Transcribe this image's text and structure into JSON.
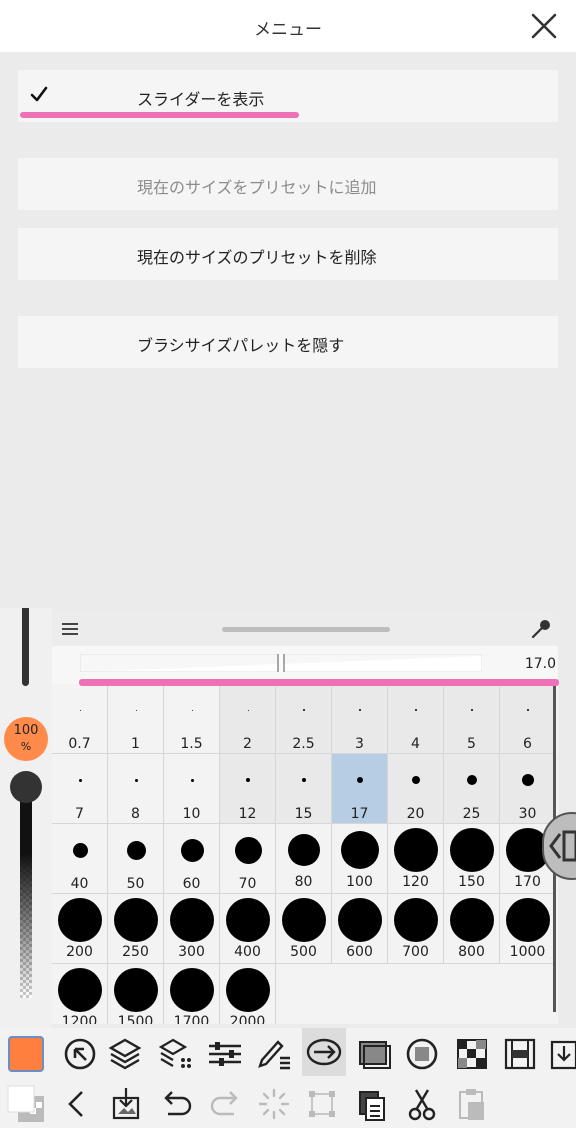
{
  "menu": {
    "title": "メニュー",
    "items": [
      {
        "label": "スライダーを表示",
        "checked": true,
        "disabled": false
      },
      {
        "label": "現在のサイズをプリセットに追加",
        "checked": false,
        "disabled": true
      },
      {
        "label": "現在のサイズのプリセットを削除",
        "checked": false,
        "disabled": false
      },
      {
        "label": "ブラシサイズパレットを隠す",
        "checked": false,
        "disabled": false
      }
    ]
  },
  "opacity": {
    "value": "100",
    "unit": "%",
    "level": 1.0
  },
  "brush_size": {
    "current": "17.0",
    "slider_fraction": 0.5,
    "selected": "17",
    "presets": [
      "0.7",
      "1",
      "1.5",
      "2",
      "2.5",
      "3",
      "4",
      "5",
      "6",
      "7",
      "8",
      "10",
      "12",
      "15",
      "17",
      "20",
      "25",
      "30",
      "40",
      "50",
      "60",
      "70",
      "80",
      "100",
      "120",
      "150",
      "170",
      "200",
      "250",
      "300",
      "400",
      "500",
      "600",
      "700",
      "800",
      "1000",
      "1200",
      "1500",
      "1700",
      "2000"
    ]
  },
  "colors": {
    "accent_pink": "#ee71b5",
    "main_color": "#ff7f3f",
    "selection": "#b7cde3"
  },
  "toolbar_icons_row1": [
    "color-swatch",
    "navigator-icon",
    "layers-icon",
    "layer-property-icon",
    "adjust-sliders-icon",
    "pen-list-icon",
    "transform-icon",
    "window-icon",
    "subtool-icon",
    "material-grid-icon",
    "film-icon",
    "download-icon"
  ],
  "toolbar_icons_row2": [
    "color-pair-icon",
    "back-icon",
    "import-icon",
    "undo-icon",
    "redo-icon",
    "loading-icon",
    "select-frame-icon",
    "copy-icon",
    "cut-icon",
    "paste-icon"
  ]
}
